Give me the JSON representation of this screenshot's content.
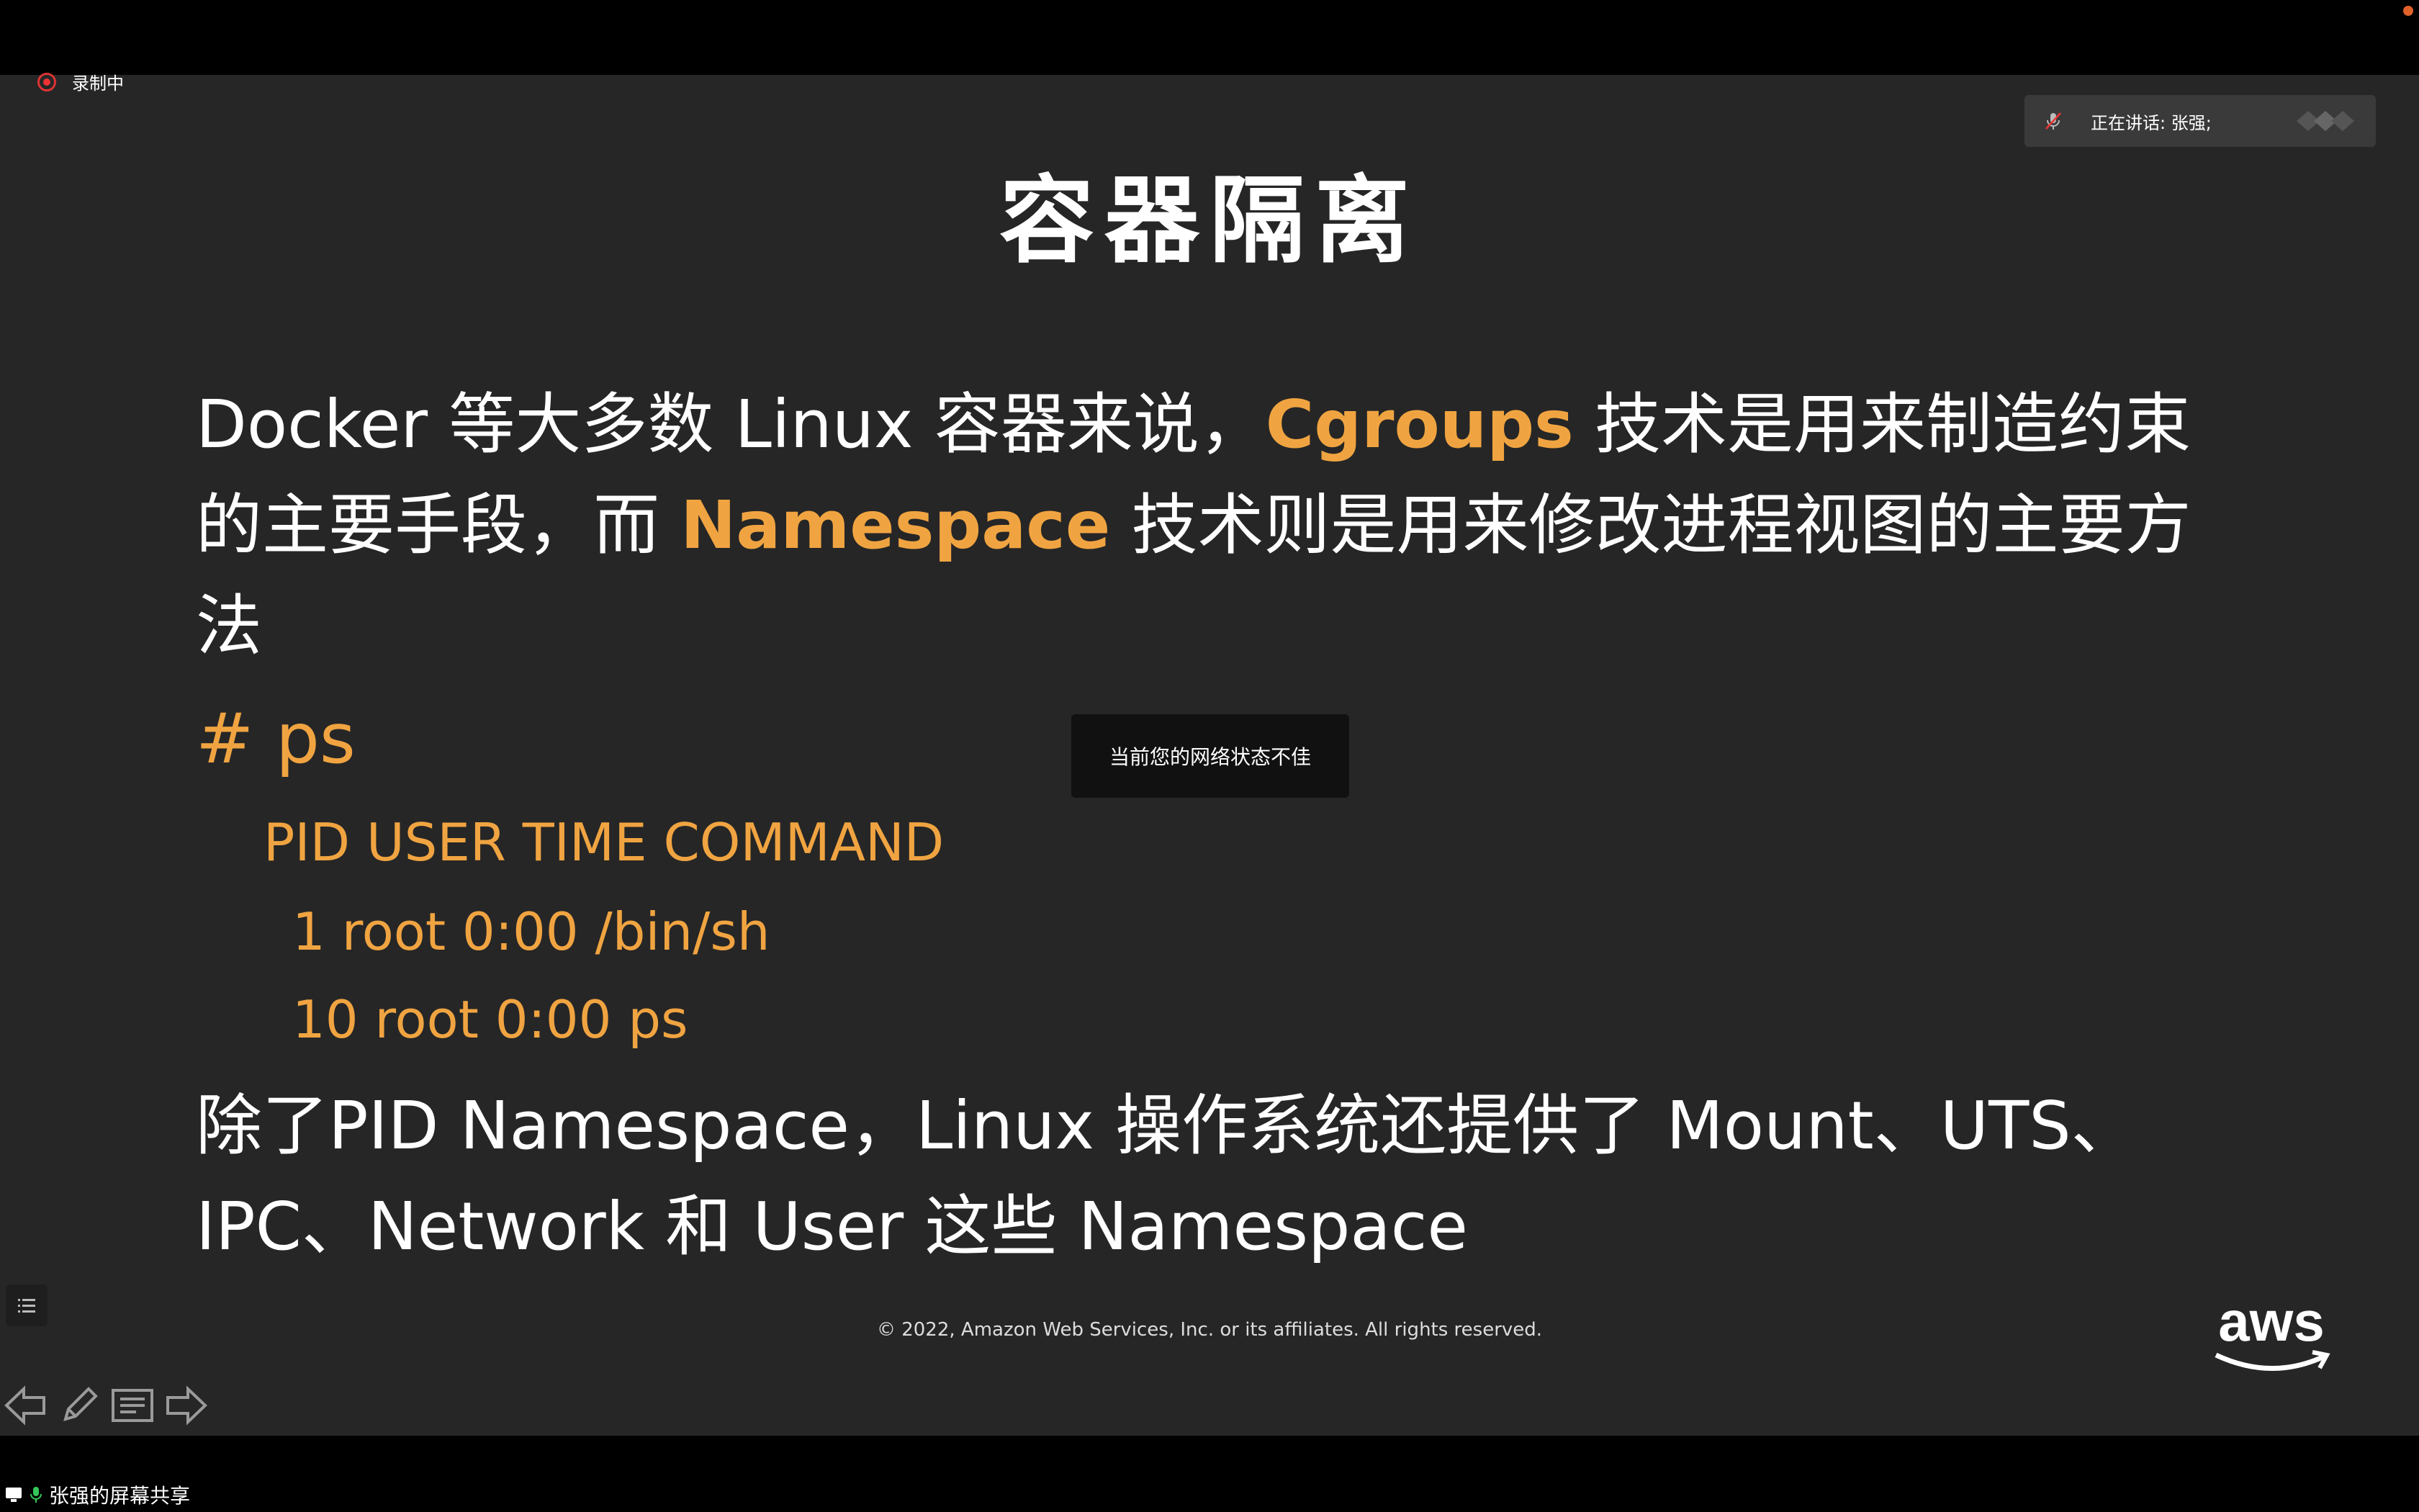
{
  "recording": {
    "label": "录制中"
  },
  "speaker": {
    "label": "正在讲话: 张强;"
  },
  "slide": {
    "title": "容器隔离",
    "para1": {
      "t1": "Docker 等大多数 Linux 容器来说，",
      "h1": "Cgroups",
      "t2": " 技术是用来制造约束",
      "t3": "的主要手段，而 ",
      "h2": "Namespace",
      "t4": " 技术则是用来修改进程视图的主要方",
      "t5": "法"
    },
    "code": {
      "prompt": "# ps",
      "header": "PID  USER   TIME COMMAND",
      "rows": [
        "1 root    0:00 /bin/sh",
        "10 root   0:00 ps"
      ]
    },
    "para2": {
      "line1": "除了PID Namespace，Linux 操作系统还提供了 Mount、UTS、",
      "line2": "IPC、Network 和 User 这些 Namespace"
    },
    "footer": "© 2022, Amazon Web Services, Inc. or its affiliates. All rights reserved.",
    "logo_text": "aws"
  },
  "toast": {
    "text": "当前您的网络状态不佳"
  },
  "toolbar": {
    "icons": [
      "previous-arrow-icon",
      "pen-icon",
      "notes-icon",
      "next-arrow-icon"
    ]
  },
  "share": {
    "label": "张强的屏幕共享"
  },
  "colors": {
    "accent": "#f0a441",
    "slide_bg": "#262626",
    "bar_bg": "#000000"
  }
}
